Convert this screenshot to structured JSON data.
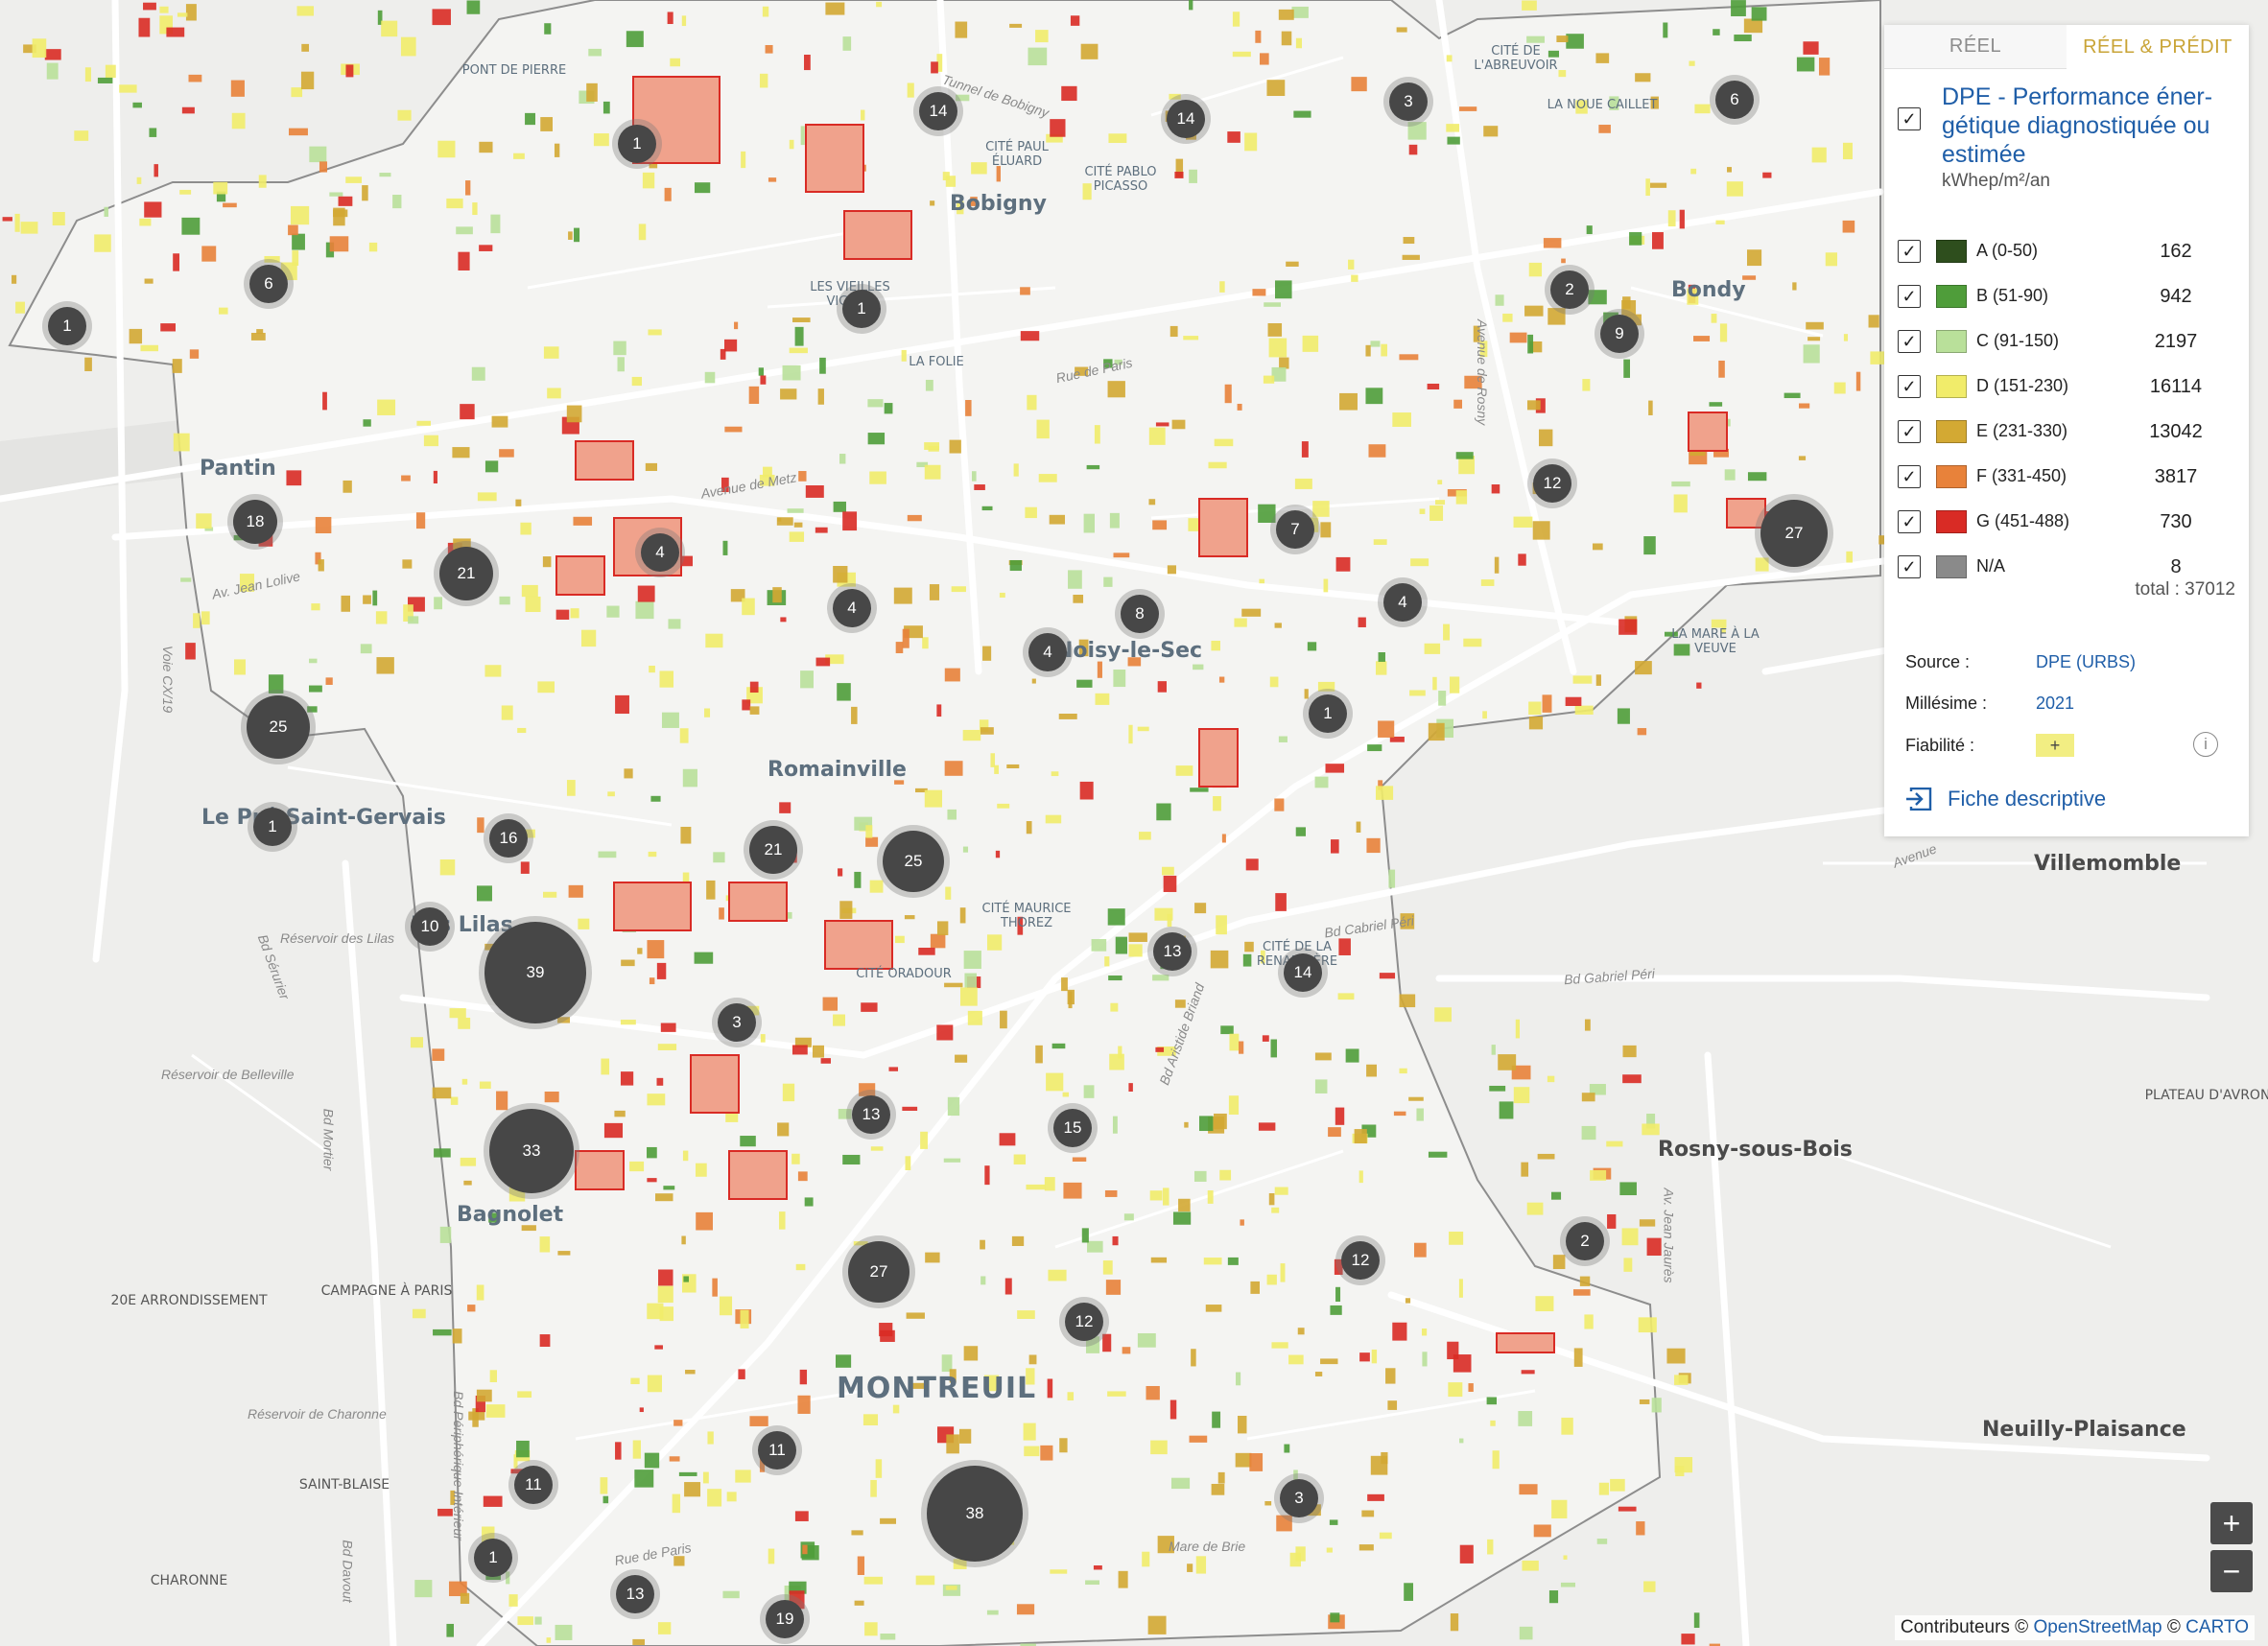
{
  "tabs": {
    "real": "RÉEL",
    "real_pred": "RÉEL & PRÉDIT",
    "active": "real_pred"
  },
  "layer": {
    "title": "DPE - Performance éner- gétique diagnostiquée ou estimée",
    "unit": "kWhep/m²/an",
    "checked": true
  },
  "legend": [
    {
      "label": "A (0-50)",
      "count": "162",
      "color": "#2e4e1d"
    },
    {
      "label": "B (51-90)",
      "count": "942",
      "color": "#4f9d3a"
    },
    {
      "label": "C (91-150)",
      "count": "2197",
      "color": "#b9e09a"
    },
    {
      "label": "D (151-230)",
      "count": "16114",
      "color": "#f1ec6a"
    },
    {
      "label": "E (231-330)",
      "count": "13042",
      "color": "#d3a933"
    },
    {
      "label": "F (331-450)",
      "count": "3817",
      "color": "#e8823a"
    },
    {
      "label": "G (451-488)",
      "count": "730",
      "color": "#d92b25"
    },
    {
      "label": "N/A",
      "count": "8",
      "color": "#8a8a8a"
    }
  ],
  "total": {
    "label": "total :",
    "value": "37012"
  },
  "meta": {
    "source_label": "Source :",
    "source_value": "DPE (URBS)",
    "millesime_label": "Millésime :",
    "millesime_value": "2021",
    "fiabilite_label": "Fiabilité :",
    "fiabilite_value": "+"
  },
  "fiche": "Fiche descriptive",
  "zoom": {
    "in": "+",
    "out": "−"
  },
  "attribution": {
    "prefix": "Contributeurs ©",
    "osm": "OpenStreetMap",
    "sep": "©",
    "carto": "CARTO"
  },
  "places": [
    {
      "t": "Bobigny",
      "cls": "big"
    },
    {
      "t": "Bondy",
      "cls": "big"
    },
    {
      "t": "Pantin",
      "cls": "big"
    },
    {
      "t": "Romainville",
      "cls": "big"
    },
    {
      "t": "Noisy-le-Sec",
      "cls": "big"
    },
    {
      "t": "Le Pré-Saint-Gervais",
      "cls": "big"
    },
    {
      "t": "Les Lilas",
      "cls": "big"
    },
    {
      "t": "Bagnolet",
      "cls": "big"
    },
    {
      "t": "MONTREUIL",
      "cls": "huge"
    },
    {
      "t": "Villemomble",
      "cls": "dark"
    },
    {
      "t": "Rosny-sous-Bois",
      "cls": "dark"
    },
    {
      "t": "Neuilly-Plaisance",
      "cls": "dark"
    },
    {
      "t": "PONT DE PIERRE",
      "cls": "small"
    },
    {
      "t": "CITÉ DE L'ABREUVOIR",
      "cls": "small"
    },
    {
      "t": "LA NOUE CAILLET",
      "cls": "small"
    },
    {
      "t": "CITÉ PAUL ÉLUARD",
      "cls": "small"
    },
    {
      "t": "CITÉ PABLO PICASSO",
      "cls": "small"
    },
    {
      "t": "LES VIEILLES VIGNES",
      "cls": "small"
    },
    {
      "t": "LA FOLIE",
      "cls": "small"
    },
    {
      "t": "LA MARE À LA VEUVE",
      "cls": "small"
    },
    {
      "t": "CITÉ MAURICE THOREZ",
      "cls": "small"
    },
    {
      "t": "CITÉ ORADOUR",
      "cls": "small"
    },
    {
      "t": "CITÉ DE LA RENARDIÈRE",
      "cls": "small"
    },
    {
      "t": "20E ARRONDISSEMENT",
      "cls": "darksmall"
    },
    {
      "t": "CAMPAGNE À PARIS",
      "cls": "darksmall"
    },
    {
      "t": "SAINT-BLAISE",
      "cls": "darksmall"
    },
    {
      "t": "CHARONNE",
      "cls": "darksmall"
    },
    {
      "t": "PLATEAU D'AVRON",
      "cls": "darksmall"
    }
  ],
  "roads": [
    "Tunnel de Bobigny",
    "Rue de Paris",
    "Avenue de Metz",
    "Av. Jean Lolive",
    "Voie CX/19",
    "Bd Sérurier",
    "Bd Mortier",
    "Bd Gabriel Péri",
    "Av. Jean Jaurès",
    "Bd Périphérique Intérieur",
    "Bd Davout",
    "Rue de Paris",
    "Mare de Brie",
    "Réservoir de Belleville",
    "Réservoir de Charonne",
    "Avenue de Rosny",
    "Bd Aristide Briand",
    "Réservoir des Lilas",
    "Bd Cabriel Péri",
    "Avenue"
  ],
  "clusters": [
    "1",
    "14",
    "14",
    "3",
    "6",
    "1",
    "1",
    "6",
    "2",
    "9",
    "12",
    "27",
    "18",
    "21",
    "4",
    "4",
    "7",
    "4",
    "8",
    "4",
    "1",
    "25",
    "1",
    "16",
    "21",
    "25",
    "10",
    "39",
    "3",
    "13",
    "14",
    "13",
    "15",
    "33",
    "27",
    "12",
    "12",
    "2",
    "11",
    "11",
    "1",
    "38",
    "3",
    "13",
    "19"
  ]
}
